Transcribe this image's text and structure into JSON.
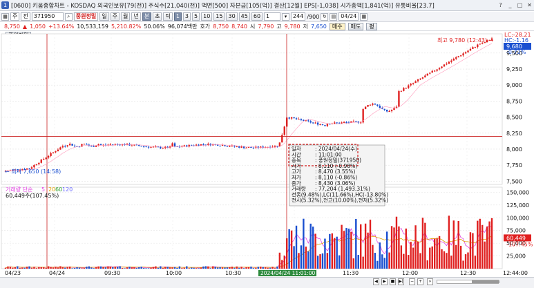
{
  "window": {
    "title": "[0600] 키움종합차트 - KOSDAQ 외국인보유[79(천)] 주식수[21,040(천)] 액면[500] 자본금[105(억)] 결산[12월] EPS[-1,038] 시가총액[1,841(억)] 유통비율[23.7]",
    "buttons": [
      "?",
      "_",
      "□",
      "✕"
    ]
  },
  "toolbar": {
    "mode": "주",
    "scope": "전",
    "code": "371950",
    "stock_name": "풍원정밀",
    "periods": [
      "일",
      "주",
      "월",
      "년",
      "분",
      "초",
      "틱"
    ],
    "active_period": "분",
    "intervals": [
      "1",
      "3",
      "5",
      "10",
      "15",
      "30",
      "45",
      "60"
    ],
    "active_interval": "1",
    "interval_select": "1",
    "count": "244",
    "count_max": "/900",
    "date": "04/24"
  },
  "quote": {
    "price": "8,750",
    "change": "1,050",
    "change_pct": "+13.64%",
    "volume": "10,533,159",
    "volume_pct": "5,210.82%",
    "ratio": "50.06%",
    "amount": "96,074백만",
    "ask_label": "호가",
    "ask": "8,750",
    "bid": "8,740",
    "open_label": "시",
    "open": "7,790",
    "high_label": "고",
    "high": "9,780",
    "low_label": "저",
    "low": "7,650",
    "buy_label": "매수",
    "sell_label": "매도",
    "flat_label": "평"
  },
  "sub_button": "풍원정밀",
  "chart": {
    "price_axis": [
      {
        "v": 9500,
        "t": "9,500"
      },
      {
        "v": 9250,
        "t": "9,250"
      },
      {
        "v": 9000,
        "t": "9,000"
      },
      {
        "v": 8750,
        "t": "8,750"
      },
      {
        "v": 8500,
        "t": "8,500"
      },
      {
        "v": 8250,
        "t": "8,250"
      },
      {
        "v": 8000,
        "t": "8,000"
      },
      {
        "v": 7750,
        "t": "7,750"
      },
      {
        "v": 7500,
        "t": "7,500"
      }
    ],
    "volume_axis": [
      {
        "v": 150000,
        "t": "150,000"
      },
      {
        "v": 125000,
        "t": "125,000"
      },
      {
        "v": 100000,
        "t": "100,000"
      },
      {
        "v": 75000,
        "t": "75,000"
      },
      {
        "v": 50000,
        "t": "50,000"
      },
      {
        "v": 25000,
        "t": "25,000"
      }
    ],
    "axis_badges": {
      "lc": "LC:-28.21",
      "hc": "HC:-1.16",
      "last_price": "9,680",
      "last_pct": "-0.72%",
      "vol_badge": "60,449",
      "vol_pct": "-107.45%"
    },
    "high_label": "최고 9,780 (12:43)",
    "low_label": "최저 7,650 (14:58)",
    "tooltip": {
      "rows": [
        [
          "일자",
          "2024/04/24(수)"
        ],
        [
          "시간",
          "11:01:00"
        ],
        [
          "종목",
          "풍원정밀(371950)"
        ],
        [
          "시가",
          "8,110 (-0.98%)"
        ],
        [
          "고가",
          "8,470 (3.55%)"
        ],
        [
          "저가",
          "8,110 (-0.86%)"
        ],
        [
          "종가",
          "8,430 (3.06%)"
        ],
        [
          "거래량",
          "77,204 (1,493.31%)"
        ]
      ],
      "extra": [
        "전종(9.48%),LC(11.66%),HC(-13.80%)",
        "전시(5.32%),전고(10.00%),전저(5.32%)"
      ]
    },
    "volume_legend": {
      "label": "거래량",
      "type": "단순",
      "periods": [
        "5",
        "20",
        "60",
        "120"
      ],
      "period_colors": [
        "#e040e0",
        "#e0a000",
        "#2a9c2a",
        "#6a6aff"
      ],
      "value": "60,449주(107.45%)"
    },
    "time_axis": [
      "04/23",
      "04/24",
      "09:30",
      "10:00",
      "10:30",
      "11:00",
      "11:30",
      "12:00",
      "12:30"
    ],
    "crosshair_time": "2024/04/24 11:01:00",
    "end_time": "12:44:00"
  },
  "colors": {
    "up": "#e02020",
    "down": "#1a4fd0",
    "crosshair": "#cc2222",
    "ma": "#cc2222"
  },
  "chart_data": {
    "type": "candlestick",
    "x_range": [
      "04/23 14:58",
      "04/24 12:44"
    ],
    "price_ylim": [
      7450,
      9800
    ],
    "volume_ylim": [
      0,
      160000
    ],
    "key_points": [
      {
        "time": "04/23 14:58",
        "price": 7650,
        "label": "최저"
      },
      {
        "time": "04/24 11:01",
        "open": 8110,
        "high": 8470,
        "low": 8110,
        "close": 8430,
        "volume": 77204
      },
      {
        "time": "04/24 12:43",
        "price": 9780,
        "label": "최고"
      }
    ],
    "last_price": 9680,
    "last_volume": 60449,
    "crosshair_price": 8200
  }
}
